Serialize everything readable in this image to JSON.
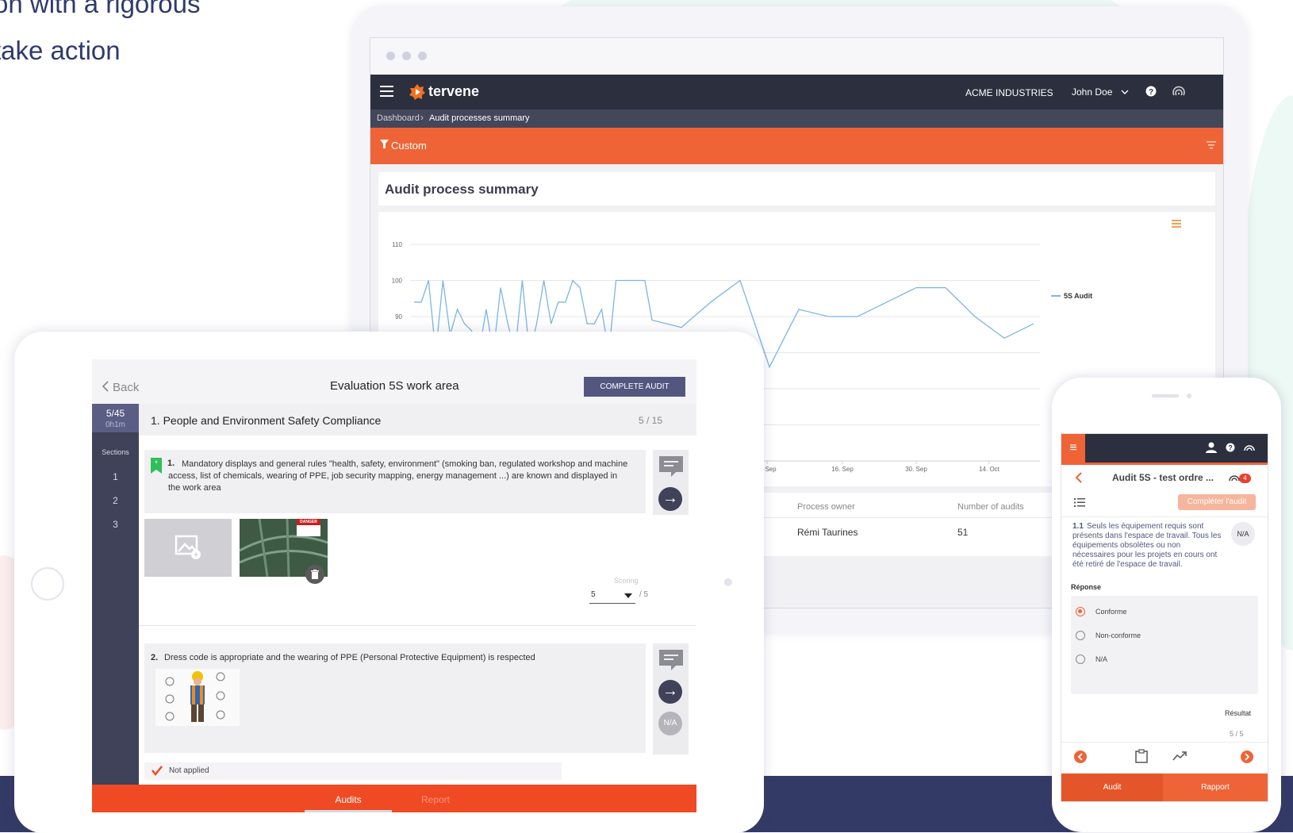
{
  "hero": {
    "line1": "on with a rigorous",
    "line2": "take action"
  },
  "laptop": {
    "brand": "tervene",
    "company": "ACME INDUSTRIES",
    "user": "John Doe",
    "breadcrumb": [
      "Dashboard",
      "Audit processes summary"
    ],
    "filter_label": "Custom",
    "card_title": "Audit process summary",
    "table_headers": [
      "Process owner",
      "Number of audits"
    ],
    "table_row": [
      "Rémi Taurines",
      "51"
    ],
    "icons": {
      "menu": "menu-icon",
      "help": "help-icon",
      "fingerprint": "fingerprint-icon",
      "filter": "filter-icon",
      "export": "export-menu-icon"
    }
  },
  "chart_data": {
    "type": "line",
    "series": [
      {
        "name": "5S Audit",
        "values": [
          94,
          94,
          100,
          80,
          100,
          85,
          92,
          88,
          86,
          80,
          92,
          80,
          98,
          88,
          80,
          100,
          80,
          88,
          100,
          88,
          94,
          94,
          100,
          98,
          88,
          88,
          92,
          80,
          100,
          100,
          100,
          100,
          100,
          89,
          87,
          94,
          100,
          76,
          92,
          90,
          90,
          94,
          98,
          98,
          90,
          84,
          88
        ]
      },
      {
        "name": "",
        "values": []
      }
    ],
    "x_ticks": [
      "2. Sep",
      "16. Sep",
      "30. Sep",
      "14. Oct"
    ],
    "y_ticks": [
      110,
      100,
      90
    ],
    "ylim": [
      50,
      110
    ],
    "grid": true,
    "legend_position": "right",
    "color": "#7cb5e6"
  },
  "tablet": {
    "back_label": "Back",
    "title": "Evaluation 5S work area",
    "complete_button": "COMPLETE AUDIT",
    "progress": "5/45",
    "elapsed": "0h1m",
    "sections_label": "Sections",
    "sections": [
      "1",
      "2",
      "3"
    ],
    "section_title": "1. People and Environment Safety Compliance",
    "section_score": "5 / 15",
    "q1_num": "1.",
    "q1_text": "Mandatory displays and general rules \"health, safety, environment\" (smoking ban, regulated workshop and machine access, list of chemicals, wearing of PPE, job security mapping, energy management ...) are known and displayed in the work area",
    "scoring_label": "Scoring",
    "scoring_value": "5",
    "scoring_max": "/ 5",
    "q2_num": "2.",
    "q2_text": "Dress code is appropriate and the wearing of PPE (Personal Protective Equipment) is respected",
    "na_label": "N/A",
    "not_applied": "Not applied",
    "danger_sign": "DANGER",
    "tabs": [
      "Audits",
      "Report"
    ],
    "accent": "#ef4a23",
    "dark": "#3f4258"
  },
  "phone": {
    "title": "Audit 5S - test ordre ...",
    "badge": "4",
    "complete_button": "Compléter l'audit",
    "q_num": "1.1",
    "q_text": "Seuls les équipement requis sont présents dans l'espace de travail. Tous les équipements obsolètes ou non nécessaires pour les projets en cours ont été retiré de l'espace de travail.",
    "na_label": "N/A",
    "response_label": "Réponse",
    "options": [
      "Conforme",
      "Non-conforme",
      "N/A"
    ],
    "selected": "Conforme",
    "result_label": "Résultat",
    "result_value": "5 / 5",
    "tabs": [
      "Audit",
      "Rapport"
    ],
    "accent": "#ee6437"
  }
}
